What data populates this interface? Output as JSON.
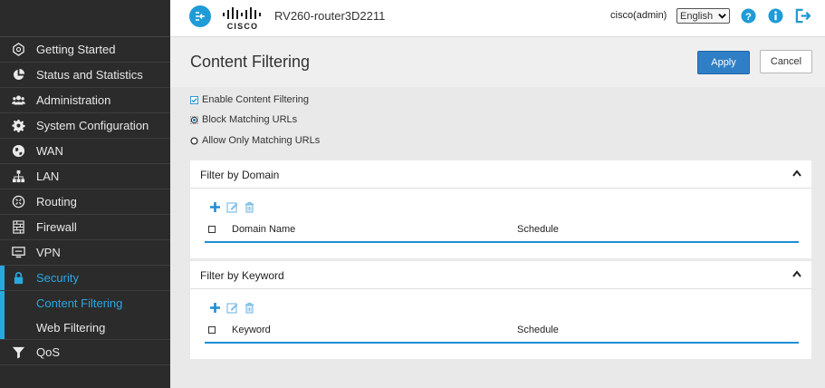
{
  "header": {
    "device_name": "RV260-router3D2211",
    "logo_text": "CISCO",
    "user": "cisco(admin)",
    "language": "English"
  },
  "sidebar": {
    "items": [
      {
        "label": "Getting Started",
        "icon": "getting-started-icon"
      },
      {
        "label": "Status and Statistics",
        "icon": "pie-chart-icon"
      },
      {
        "label": "Administration",
        "icon": "users-icon"
      },
      {
        "label": "System Configuration",
        "icon": "gear-icon"
      },
      {
        "label": "WAN",
        "icon": "globe-icon"
      },
      {
        "label": "LAN",
        "icon": "network-icon"
      },
      {
        "label": "Routing",
        "icon": "router-icon"
      },
      {
        "label": "Firewall",
        "icon": "firewall-icon"
      },
      {
        "label": "VPN",
        "icon": "monitor-icon"
      },
      {
        "label": "Security",
        "icon": "lock-icon",
        "active": true
      },
      {
        "label": "QoS",
        "icon": "filter-icon"
      }
    ],
    "security_sub": [
      {
        "label": "Content Filtering",
        "active": true
      },
      {
        "label": "Web Filtering"
      }
    ]
  },
  "page": {
    "title": "Content Filtering",
    "apply_label": "Apply",
    "cancel_label": "Cancel"
  },
  "options": {
    "enable_label": "Enable Content Filtering",
    "enable_checked": true,
    "block_label": "Block Matching URLs",
    "block_selected": true,
    "allow_label": "Allow Only Matching URLs",
    "allow_selected": false
  },
  "domain_panel": {
    "title": "Filter by Domain",
    "col1": "Domain Name",
    "col2": "Schedule"
  },
  "keyword_panel": {
    "title": "Filter by Keyword",
    "col1": "Keyword",
    "col2": "Schedule"
  },
  "colors": {
    "accent": "#29a8e0",
    "sidebar_bg": "#2b2b2b",
    "apply_btn": "#2f7fc6"
  }
}
